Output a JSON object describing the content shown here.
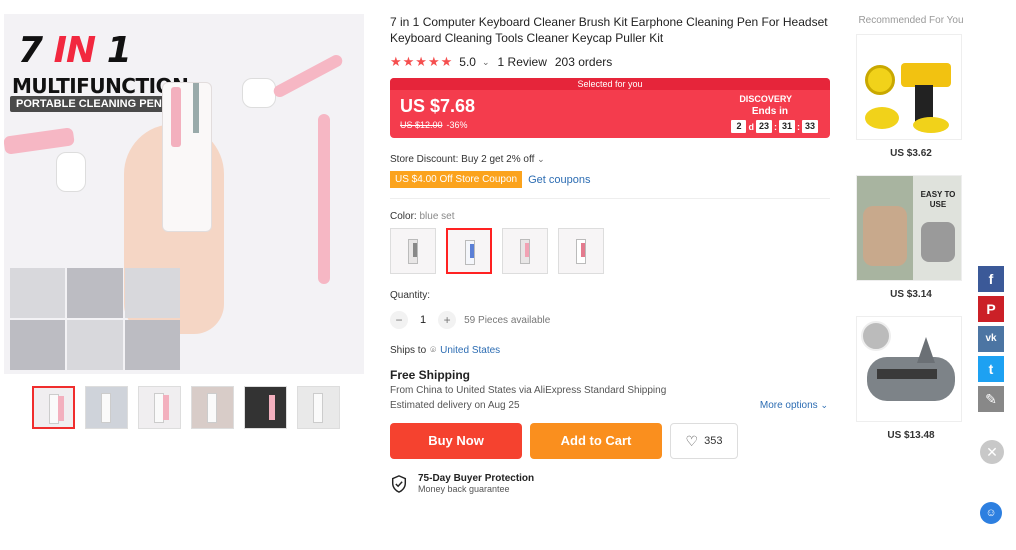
{
  "gallery": {
    "hero_line1_a": "7",
    "hero_line1_b": "IN",
    "hero_line1_c": "1",
    "hero_line2": "MULTIFUNCTION",
    "hero_line3": "PORTABLE CLEANING PEN",
    "thumb_count": 6,
    "active_thumb": 0
  },
  "product": {
    "title": "7 in 1 Computer Keyboard Cleaner Brush Kit Earphone Cleaning Pen For Headset Keyboard Cleaning Tools Cleaner Keycap Puller Kit",
    "rating": "5.0",
    "stars": "★★★★★",
    "reviews": "1 Review",
    "orders": "203 orders"
  },
  "price": {
    "banner": "Selected for you",
    "current": "US $7.68",
    "original": "US $12.00",
    "discount": "-36%",
    "promo_label": "DISCOVERY",
    "ends_in": "Ends in",
    "countdown": {
      "days": "2",
      "d_label": "d",
      "hours": "23",
      "minutes": "31",
      "seconds": "33"
    }
  },
  "store": {
    "discount": "Store Discount: Buy 2 get 2% off",
    "coupon": "US $4.00 Off Store Coupon",
    "get_coupons": "Get coupons"
  },
  "color": {
    "label": "Color:",
    "selected": "blue set",
    "options": [
      "grey set",
      "blue set",
      "pink set",
      "white set"
    ],
    "selected_index": 1
  },
  "quantity": {
    "label": "Quantity:",
    "value": "1",
    "available": "59 Pieces available"
  },
  "shipping": {
    "ships_to_label": "Ships to",
    "country": "United States",
    "free": "Free Shipping",
    "detail": "From China to United States via AliExpress Standard Shipping",
    "delivery": "Estimated delivery on Aug 25",
    "more_options": "More options"
  },
  "actions": {
    "buy_now": "Buy Now",
    "add_to_cart": "Add to Cart",
    "wishlist_count": "353"
  },
  "protection": {
    "title": "75-Day Buyer Protection",
    "subtitle": "Money back guarantee"
  },
  "recommended": {
    "title": "Recommended For You",
    "items": [
      {
        "price": "US $3.62"
      },
      {
        "price": "US $3.14",
        "image_text": "EASY TO USE"
      },
      {
        "price": "US $13.48"
      }
    ]
  },
  "social": {
    "facebook": "f",
    "pinterest": "P",
    "vk": "vk",
    "twitter": "t",
    "edit": "✎",
    "close": "✕"
  },
  "colors": {
    "accent": "#f43c4d",
    "buy": "#f5422f",
    "cart": "#fa8f1e",
    "coupon": "#fba31d",
    "link": "#2d6db3"
  }
}
